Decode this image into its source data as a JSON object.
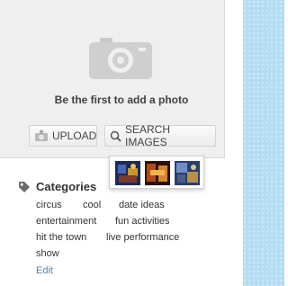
{
  "photo_panel": {
    "prompt": "Be the first to add a photo",
    "upload_label": "UPLOAD",
    "search_label": "SEARCH IMAGES",
    "icons": [
      "camera-icon",
      "upload-icon",
      "search-icon"
    ]
  },
  "thumbnails": [
    {
      "name": "thumbnail-1"
    },
    {
      "name": "thumbnail-2"
    },
    {
      "name": "thumbnail-3"
    }
  ],
  "categories": {
    "title": "Categories",
    "tags": [
      "circus",
      "cool",
      "date ideas",
      "entertainment",
      "fun activities",
      "hit the town",
      "live performance",
      "show"
    ],
    "edit_label": "Edit"
  },
  "colors": {
    "accent_link": "#4a86b8",
    "side_strip": "#b4dcf2",
    "panel_bg": "#efefef"
  }
}
